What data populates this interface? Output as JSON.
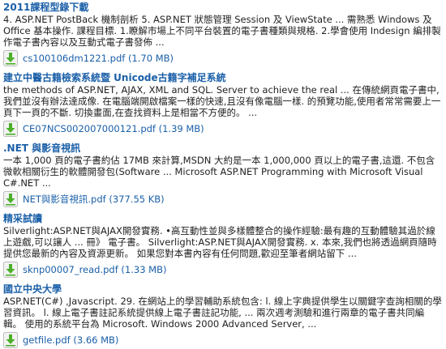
{
  "results": [
    {
      "title": "2011課程型錄下載",
      "snippet": "4. ASP.NET PostBack 機制剖析 5. ASP.NET 狀態管理 Session 及 ViewState ... 需熟悉 Windows 及 Office 基本操作. 課程目標. 1.瞭解市場上不同平台裝置的電子書種類與規格. 2.學會使用 Indesign 編排製作電子書內容以及互動式電子書發佈 ...",
      "file": "cs100106dm1221.pdf (1.70 MB)"
    },
    {
      "title": "建立中醫古籍檢索系統暨 Unicode古籍字補足系統",
      "snippet": "the methods of ASP.NET, AJAX, XML and SQL. Server to achieve the real ... 在傳統網頁電子書中,我們並沒有辦法達成像. 在電腦端開啟檔案一樣的快速,且沒有像電腦一樣. 的預覽功能,使用者常常需要上一頁下一頁的不斷. 切換畫面,在查找資料上是相當不方便的。 ...",
      "file": "CE07NCS002007000121.pdf (1.39 MB)"
    },
    {
      "title": ".NET 與影音視訊",
      "snippet": "一本 1,000 頁的電子書約佔 17MB 來計算,MSDN 大約是一本 1,000,000 頁以上的電子書,這還. 不包含微軟相關衍生的軟體開發包(Software ... Microsoft ASP.NET Programming with Microsoft Visual C#.NET ...",
      "file": "NET與影音視訊.pdf (377.55 KB)"
    },
    {
      "title": "精采試讀",
      "snippet": "Silverlight:ASP.NET與AJAX開發實務. •高互動性並與多樣體整合的操作經驗:最有趣的互動體驗其過於線上遊戲,可以讓人 ... 冊》 電子書。 Silverlight:ASP.NET與AJAX開發實務. x. 本來,我們也將透過網頁隨時提供您最新的內容及資源更新。 如果您對本書內容有任何問題,歡迎至筆者網站留下 ...",
      "file": "sknp00007_read.pdf (1.33 MB)"
    },
    {
      "title": "國立中央大學",
      "snippet": "ASP.NET(C#) ,Javascript. 29. 在網站上的學習輔助系統包含: l. 線上字典提供學生以關鍵字查詢相關的學習資訊。 l. 線上電子書註記系統提供線上電子書註記功能, ... 兩次週考測驗和進行兩章的電子書共同編輯。 使用的系統平台為 Microsoft. Windows 2000 Advanced Server, ...",
      "file": "getfile.pdf (3.66 MB)"
    }
  ],
  "colors": {
    "title": "#1a5fa8",
    "link": "#1a5fa8",
    "text": "#222222",
    "icon_green": "#4caf2a"
  },
  "icons": {
    "download": "download-arrow-icon"
  }
}
